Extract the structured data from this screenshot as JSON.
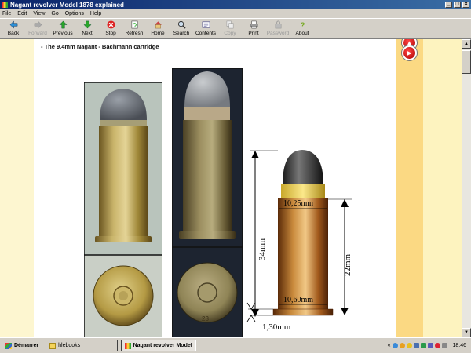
{
  "window": {
    "title": "Nagant revolver Model 1878 explained"
  },
  "menu": [
    "File",
    "Edit",
    "View",
    "Go",
    "Options",
    "Help"
  ],
  "toolbar": [
    {
      "label": "Back",
      "icon": "back-arrow-icon",
      "enabled": true
    },
    {
      "label": "Forward",
      "icon": "forward-arrow-icon",
      "enabled": false
    },
    {
      "label": "Previous",
      "icon": "previous-arrow-icon",
      "enabled": true
    },
    {
      "label": "Next",
      "icon": "next-arrow-icon",
      "enabled": true
    },
    {
      "label": "Stop",
      "icon": "stop-icon",
      "enabled": true
    },
    {
      "label": "Refresh",
      "icon": "refresh-icon",
      "enabled": true
    },
    {
      "label": "Home",
      "icon": "home-icon",
      "enabled": true
    },
    {
      "label": "Search",
      "icon": "search-icon",
      "enabled": true
    },
    {
      "label": "Contents",
      "icon": "contents-icon",
      "enabled": true
    },
    {
      "label": "Copy",
      "icon": "copy-icon",
      "enabled": false
    },
    {
      "label": "Print",
      "icon": "print-icon",
      "enabled": true
    },
    {
      "label": "Password",
      "icon": "password-icon",
      "enabled": false
    },
    {
      "label": "About",
      "icon": "about-icon",
      "enabled": true
    }
  ],
  "page": {
    "heading": "- The 9.4mm Nagant - Bachmann cartridge",
    "diagram": {
      "length_label": "34mm",
      "case_length_label": "22mm",
      "bullet_diameter_label": "10,25mm",
      "base_diameter_label": "10,60mm",
      "rim_label": "1,30mm"
    },
    "headstamp": "23"
  },
  "taskbar": {
    "start_label": "Démarrer",
    "tasks": [
      {
        "label": "hlebooks",
        "active": false
      },
      {
        "label": "Nagant revolver Model...",
        "active": true
      }
    ],
    "clock": "18:46",
    "tray_chevron": "«"
  },
  "colors": {
    "titlebar": "#0a246a",
    "page_bg": "#fdf3bf",
    "sidebar_orange": "#fbd983"
  }
}
